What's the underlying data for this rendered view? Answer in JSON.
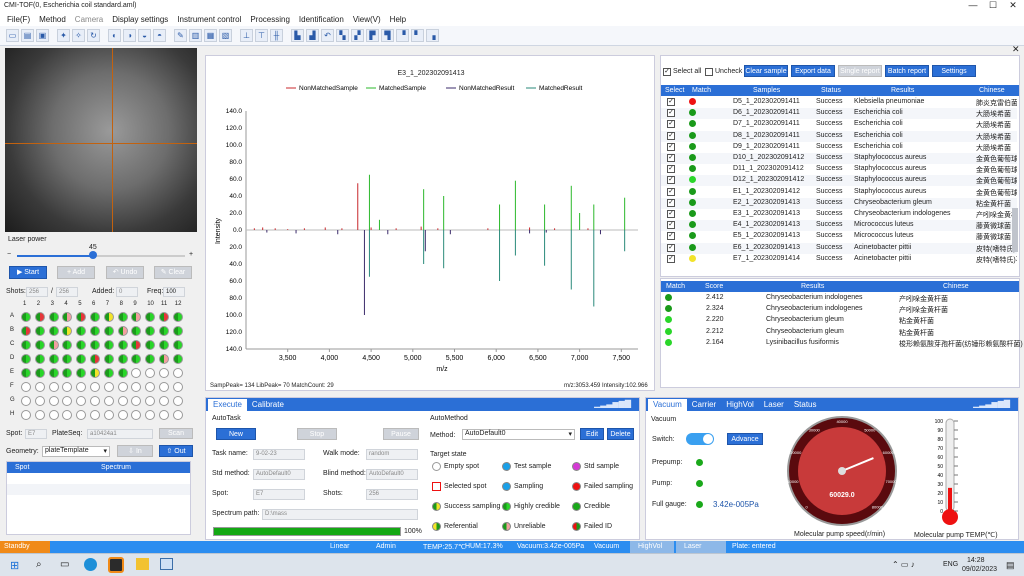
{
  "window": {
    "title": "CMI-TOF(0, Escherichia coil standard.aml)",
    "min": "—",
    "max": "☐",
    "close": "✕"
  },
  "menu": [
    "File(F)",
    "Method",
    "Camera",
    "Display settings",
    "Instrument control",
    "Processing",
    "Identification",
    "View(V)",
    "Help"
  ],
  "laser": {
    "label": "Laser power",
    "value": "45",
    "fraction": 0.45,
    "minus": "−",
    "plus": "+"
  },
  "actions": {
    "start": "Start",
    "add": "Add",
    "undo": "Undo",
    "clear": "Clear"
  },
  "shots": {
    "label": "Shots:",
    "value": "256",
    "slash": "/",
    "total": "256",
    "added_label": "Added:",
    "added": "0",
    "freq_label": "Freq:",
    "freq": "100"
  },
  "plate": {
    "cols": [
      "1",
      "2",
      "3",
      "4",
      "5",
      "6",
      "7",
      "8",
      "9",
      "10",
      "11",
      "12"
    ],
    "rows": [
      "A",
      "B",
      "C",
      "D",
      "E",
      "F",
      "G",
      "H"
    ],
    "wells": [
      [
        "gg",
        "gr",
        "gg",
        "gp",
        "gr",
        "gg",
        "gy",
        "gg",
        "gp",
        "gg",
        "gr",
        "gg"
      ],
      [
        "gr",
        "gg",
        "gg",
        "gy",
        "gg",
        "gg",
        "gg",
        "gp",
        "gg",
        "gg",
        "gg",
        "gg"
      ],
      [
        "gg",
        "gg",
        "gp",
        "gg",
        "gg",
        "gg",
        "gg",
        "gg",
        "gr",
        "gg",
        "gg",
        "gg"
      ],
      [
        "gg",
        "gg",
        "gg",
        "gg",
        "gg",
        "gr",
        "gg",
        "gg",
        "gg",
        "gg",
        "gp",
        "gg"
      ],
      [
        "gg",
        "gg",
        "gg",
        "gg",
        "gg",
        "gy",
        "gg",
        "gg",
        "",
        "",
        "",
        ""
      ],
      [
        "",
        "",
        "",
        "",
        "",
        "",
        "",
        "",
        "",
        "",
        "",
        ""
      ],
      [
        "",
        "",
        "",
        "",
        "",
        "",
        "",
        "",
        "",
        "",
        "",
        ""
      ],
      [
        "",
        "",
        "",
        "",
        "",
        "",
        "",
        "",
        "",
        "",
        "",
        ""
      ]
    ]
  },
  "spot_row": {
    "spot_label": "Spot:",
    "spot": "E7",
    "seq_label": "PlateSeq:",
    "seq": "a10424a1",
    "scan": "Scan"
  },
  "geometry": {
    "label": "Geometry:",
    "value": "plateTemplate",
    "in": "In",
    "out": "Out"
  },
  "spot_table": {
    "h1": "Spot",
    "h2": "Spectrum"
  },
  "chart_title": "E3_1_202302091413",
  "chart_data": {
    "type": "line",
    "title": "E3_1_202302091413",
    "xlabel": "m/z",
    "ylabel": "Intensity",
    "xlim": [
      3000,
      7700
    ],
    "ylim": [
      -140,
      140
    ],
    "x_ticks": [
      "3,500",
      "4,000",
      "4,500",
      "5,000",
      "5,500",
      "6,000",
      "6,500",
      "7,000",
      "7,500"
    ],
    "x_tick_vals": [
      3500,
      4000,
      4500,
      5000,
      5500,
      6000,
      6500,
      7000,
      7500
    ],
    "y_ticks": [
      "140.0",
      "120.0",
      "100.0",
      "80.0",
      "60.0",
      "40.0",
      "20.0",
      "0.0",
      "20.0",
      "40.0",
      "60.0",
      "80.0",
      "100.0",
      "120.0",
      "140.0"
    ],
    "y_tick_vals": [
      140,
      120,
      100,
      80,
      60,
      40,
      20,
      0,
      -20,
      -40,
      -60,
      -80,
      -100,
      -120,
      -140
    ],
    "series": [
      {
        "name": "NonMatchedSample",
        "color": "#c8282c",
        "points": [
          [
            3100,
            2
          ],
          [
            3200,
            3
          ],
          [
            3350,
            2
          ],
          [
            3500,
            1
          ],
          [
            3700,
            2
          ],
          [
            3950,
            3
          ],
          [
            4150,
            2
          ],
          [
            4340,
            55
          ],
          [
            4500,
            3
          ],
          [
            4800,
            2
          ],
          [
            5100,
            4
          ],
          [
            5300,
            2
          ],
          [
            5900,
            2
          ],
          [
            6400,
            3
          ],
          [
            6700,
            2
          ],
          [
            7100,
            2
          ]
        ]
      },
      {
        "name": "MatchedSample",
        "color": "#2bb82b",
        "points": [
          [
            4480,
            65
          ],
          [
            4600,
            12
          ],
          [
            5130,
            48
          ],
          [
            5370,
            40
          ],
          [
            6040,
            30
          ],
          [
            6230,
            58
          ],
          [
            6580,
            30
          ],
          [
            6900,
            52
          ],
          [
            7000,
            20
          ],
          [
            7170,
            30
          ],
          [
            7540,
            38
          ]
        ]
      },
      {
        "name": "NonMatchedResult",
        "color": "#3b2b6b",
        "points": [
          [
            3250,
            -3
          ],
          [
            3600,
            -4
          ],
          [
            4100,
            -5
          ],
          [
            4420,
            -100
          ],
          [
            4700,
            -5
          ],
          [
            5150,
            -25
          ],
          [
            5450,
            -5
          ],
          [
            6400,
            -4
          ],
          [
            6600,
            -3
          ],
          [
            7250,
            -5
          ]
        ]
      },
      {
        "name": "MatchedResult",
        "color": "#2a8a7a",
        "points": [
          [
            4480,
            -55
          ],
          [
            5130,
            -40
          ],
          [
            5370,
            -45
          ],
          [
            6040,
            -60
          ],
          [
            6230,
            -30
          ],
          [
            6580,
            -42
          ],
          [
            6900,
            -70
          ],
          [
            7170,
            -90
          ],
          [
            7540,
            -25
          ]
        ]
      }
    ]
  },
  "chart_footer": {
    "left": "SampPeak= 134 LibPeak= 70 MatchCount: 29",
    "right": "m/z:3053.459 Intensity:102.966"
  },
  "top_right": {
    "select_all": "Select all",
    "uncheck": "Uncheck",
    "clear_sample": "Clear sample",
    "export": "Export data",
    "single": "Single report",
    "batch": "Batch report",
    "settings": "Settings"
  },
  "samples_header": [
    "Select",
    "Match",
    "Samples",
    "Status",
    "Results",
    "Chinese"
  ],
  "samples": [
    {
      "sample": "D5_1_202302091411",
      "status": "Success",
      "result": "Klebsiella pneumoniae",
      "cn": "肺炎克雷伯菌",
      "color": "#e11"
    },
    {
      "sample": "D6_1_202302091411",
      "status": "Success",
      "result": "Escherichia coli",
      "cn": "大肠埃希菌",
      "color": "#1a9a1a"
    },
    {
      "sample": "D7_1_202302091411",
      "status": "Success",
      "result": "Escherichia coli",
      "cn": "大肠埃希菌",
      "color": "#1a9a1a"
    },
    {
      "sample": "D8_1_202302091411",
      "status": "Success",
      "result": "Escherichia coli",
      "cn": "大肠埃希菌",
      "color": "#1a9a1a"
    },
    {
      "sample": "D9_1_202302091411",
      "status": "Success",
      "result": "Escherichia coli",
      "cn": "大肠埃希菌",
      "color": "#1a9a1a"
    },
    {
      "sample": "D10_1_202302091412",
      "status": "Success",
      "result": "Staphylococcus aureus",
      "cn": "金黄色葡萄球菌",
      "color": "#1a9a1a"
    },
    {
      "sample": "D11_1_202302091412",
      "status": "Success",
      "result": "Staphylococcus aureus",
      "cn": "金黄色葡萄球菌",
      "color": "#1a9a1a"
    },
    {
      "sample": "D12_1_202302091412",
      "status": "Success",
      "result": "Staphylococcus aureus",
      "cn": "金黄色葡萄球菌",
      "color": "#2ad62a"
    },
    {
      "sample": "E1_1_202302091412",
      "status": "Success",
      "result": "Staphylococcus aureus",
      "cn": "金黄色葡萄球菌",
      "color": "#1a9a1a"
    },
    {
      "sample": "E2_1_202302091413",
      "status": "Success",
      "result": "Chryseobacterium gleum",
      "cn": "粘金黄杆菌",
      "color": "#1a9a1a"
    },
    {
      "sample": "E3_1_202302091413",
      "status": "Success",
      "result": "Chryseobacterium indologenes",
      "cn": "产吲哚金黄杆菌",
      "color": "#1a9a1a"
    },
    {
      "sample": "E4_1_202302091413",
      "status": "Success",
      "result": "Micrococcus luteus",
      "cn": "藤黄微球菌",
      "color": "#1a9a1a"
    },
    {
      "sample": "E5_1_202302091413",
      "status": "Success",
      "result": "Micrococcus luteus",
      "cn": "藤黄微球菌",
      "color": "#1a9a1a"
    },
    {
      "sample": "E6_1_202302091413",
      "status": "Success",
      "result": "Acinetobacter pittii",
      "cn": "皮特(嗜特氏)不动杆",
      "color": "#1a9a1a"
    },
    {
      "sample": "E7_1_202302091414",
      "status": "Success",
      "result": "Acinetobacter pittii",
      "cn": "皮特(嗜特氏)不动杆",
      "color": "#f2e32b"
    }
  ],
  "results_header": [
    "Match",
    "Score",
    "Results",
    "Chinese"
  ],
  "results": [
    {
      "score": "2.412",
      "result": "Chryseobacterium indologenes",
      "cn": "产吲哚金黄杆菌",
      "color": "#1a9a1a"
    },
    {
      "score": "2.324",
      "result": "Chryseobacterium indologenes",
      "cn": "产吲哚金黄杆菌",
      "color": "#1a9a1a"
    },
    {
      "score": "2.220",
      "result": "Chryseobacterium gleum",
      "cn": "粘金黄杆菌",
      "color": "#2ad62a"
    },
    {
      "score": "2.212",
      "result": "Chryseobacterium gleum",
      "cn": "粘金黄杆菌",
      "color": "#2ad62a"
    },
    {
      "score": "2.164",
      "result": "Lysinibacillus fusiformis",
      "cn": "梭形赖氨酸芽孢杆菌(纺锤形赖氨酸杆菌)",
      "color": "#2ad62a"
    }
  ],
  "exec_tabs": [
    "Execute",
    "Calibrate"
  ],
  "autotask": {
    "title": "AutoTask",
    "new": "New",
    "stop": "Stop",
    "pause": "Pause",
    "task_label": "Task name:",
    "task": "9-02-23",
    "walk_label": "Walk mode:",
    "walk": "random",
    "std_label": "Std method:",
    "std": "AutoDefault0",
    "blind_label": "Blind method:",
    "blind": "AutoDefault0",
    "spot_label": "Spot:",
    "spot": "E7",
    "shots_label": "Shots:",
    "shots": "256",
    "path_label": "Spectrum path:",
    "path": "D:\\mass",
    "progress": "100%",
    "progress_frac": 1.0
  },
  "automethod": {
    "title": "AutoMethod",
    "method_label": "Method:",
    "method": "AutoDefault0",
    "edit": "Edit",
    "delete": "Delete",
    "target": "Target state",
    "states": [
      "Empty spot",
      "Test sample",
      "Std sample",
      "Selected spot",
      "Sampling",
      "Failed sampling",
      "Success sampling",
      "Highly credible",
      "Credible",
      "Referential",
      "Unreliable",
      "Failed ID"
    ]
  },
  "vac_tabs": [
    "Vacuum",
    "Carrier",
    "HighVol",
    "Laser",
    "Status"
  ],
  "vacuum": {
    "title": "Vacuum",
    "switch": "Switch:",
    "advance": "Advance",
    "prepump": "Prepump:",
    "pump": "Pump:",
    "gauge": "Full gauge:",
    "gauge_val": "3.42e-005Pa",
    "speed": "60029.0",
    "speed_label": "Molecular pump speed(r/min)",
    "temp_label": "Molecular pump TEMP(℃)"
  },
  "gauge_ticks": [
    "0",
    "10000",
    "20000",
    "30000",
    "40000",
    "50000",
    "60000",
    "70000",
    "80000"
  ],
  "thermo_ticks": [
    "100",
    "90",
    "80",
    "70",
    "60",
    "50",
    "40",
    "30",
    "20",
    "10",
    "0"
  ],
  "statusbar": {
    "s1": "Standby",
    "s2": "Linear",
    "s3": "Admin",
    "s4": "TEMP:25.7℃",
    "s5": "HUM:17.3%",
    "s6": "Vacuum:3.42e-005Pa",
    "s7": "Vacuum",
    "s8": "HighVol",
    "s9": "Laser",
    "s10": "Plate: entered"
  },
  "taskbar": {
    "time": "14:28",
    "date": "09/02/2023",
    "lang": "ENG"
  }
}
